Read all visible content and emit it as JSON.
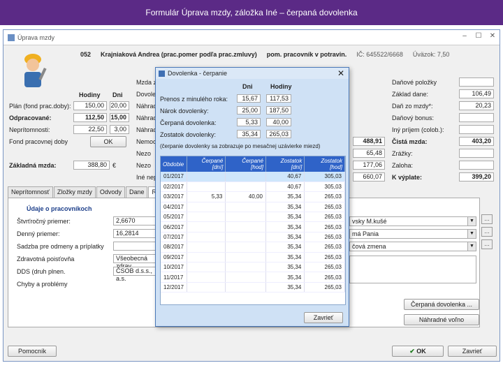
{
  "slide_title": "Formulár Úprava mzdy, záložka Iné – čerpaná dovolenka",
  "window": {
    "title": "Úprava mzdy",
    "min": "–",
    "max": "☐",
    "close": "✕"
  },
  "header": {
    "id": "052",
    "name": "Krajniaková Andrea (prac.pomer podľa prac.zmluvy)",
    "position": "pom. pracovník v potravin.",
    "ic_label": "IČ:",
    "ic_value": "645522/6668",
    "obdobie_label": "Úväzok:",
    "obdobie_value": "7,50"
  },
  "left": {
    "plan_label": "Plán (fond prac.doby):",
    "hodiny_header": "Hodiny",
    "dni_header": "Dni",
    "plan_h": "150,00",
    "plan_d": "20,00",
    "odpracovane_label": "Odpracované:",
    "odpracovane_h": "112,50",
    "odpracovane_d": "15,00",
    "nepritomnosti_label": "Neprítomnosti:",
    "nepritomnosti_h": "22,50",
    "nepritomnosti_d": "3,00",
    "fond_label": "Fond pracovnej doby",
    "fond_btn": "OK",
    "zakladna_label": "Základná mzda:",
    "zakladna_value": "388,80",
    "currency": "€"
  },
  "middle_labels": [
    "Mzda za",
    "Dovolen",
    "Náhrad",
    "Náhrad",
    "Náhrad",
    "Nemoc",
    "Nezo",
    "Nezo",
    "Iné nepr"
  ],
  "middle_values": [
    "488,91",
    "65,48",
    "177,06",
    "660,07"
  ],
  "right": {
    "labels": [
      "Daňové položky",
      "Základ dane:",
      "Daň zo mzdy*:",
      "Daňový bonus:",
      "Iný príjem (colob.):",
      "Čistá mzda:",
      "Zrážky:",
      "Zaloha:",
      "K výplate:"
    ],
    "values": [
      "",
      "106,49",
      "20,23",
      "",
      "",
      "403,20",
      "",
      "",
      "399,20"
    ]
  },
  "tabs": [
    "Neprítomnosť",
    "Zložky mzdy",
    "Odvody",
    "Dane",
    "Rozúč"
  ],
  "tab_section": "Údaje o pracovníkoch",
  "tab_labels": [
    "Štvrťročný priemer:",
    "Denný priemer:",
    "Sadzba pre odmeny a príplatky",
    "Zdravotná poisťovňa",
    "DDS (druh plnen.",
    "Chyby a problémy"
  ],
  "tab_values": [
    "2,6670",
    "16,2814",
    "",
    "Všeobecná zdrav",
    "ČSOB d.s.s., a.s."
  ],
  "tab_right_dd": [
    "vsky M.kušé",
    "má Pania",
    "čová zmena"
  ],
  "cerpana_btn": "Čerpaná dovolenka ...",
  "nahradne_btn": "Náhradné voľno",
  "bottom": {
    "pomocnik": "Pomocník",
    "ok": "OK",
    "zavriet": "Zavrieť"
  },
  "dialog": {
    "title": "Dovolenka - čerpanie",
    "close": "✕",
    "col_dni": "Dni",
    "col_hodiny": "Hodiny",
    "rows": [
      {
        "label": "Prenos z minulého roka:",
        "dni": "15,67",
        "hodiny": "117,53"
      },
      {
        "label": "Nárok dovolenky:",
        "dni": "25,00",
        "hodiny": "187,50"
      },
      {
        "label": "Čerpaná dovolenka:",
        "dni": "5,33",
        "hodiny": "40,00"
      },
      {
        "label": "Zostatok dovolenky:",
        "dni": "35,34",
        "hodiny": "265,03"
      }
    ],
    "note": "(čerpanie dovolenky sa zobrazuje po mesačnej uzávierke miezd)",
    "grid_headers": [
      "Obdobie",
      "Čerpané [dní]",
      "Čerpané [hod]",
      "Zostatok [dní]",
      "Zostatok [hod]"
    ],
    "grid_rows": [
      [
        "01/2017",
        "",
        "",
        "40,67",
        "305,03"
      ],
      [
        "02/2017",
        "",
        "",
        "40,67",
        "305,03"
      ],
      [
        "03/2017",
        "5,33",
        "40,00",
        "35,34",
        "265,03"
      ],
      [
        "04/2017",
        "",
        "",
        "35,34",
        "265,03"
      ],
      [
        "05/2017",
        "",
        "",
        "35,34",
        "265,03"
      ],
      [
        "06/2017",
        "",
        "",
        "35,34",
        "265,03"
      ],
      [
        "07/2017",
        "",
        "",
        "35,34",
        "265,03"
      ],
      [
        "08/2017",
        "",
        "",
        "35,34",
        "265,03"
      ],
      [
        "09/2017",
        "",
        "",
        "35,34",
        "265,03"
      ],
      [
        "10/2017",
        "",
        "",
        "35,34",
        "265,03"
      ],
      [
        "11/2017",
        "",
        "",
        "35,34",
        "265,03"
      ],
      [
        "12/2017",
        "",
        "",
        "35,34",
        "265,03"
      ]
    ],
    "zavriet": "Zavrieť"
  }
}
